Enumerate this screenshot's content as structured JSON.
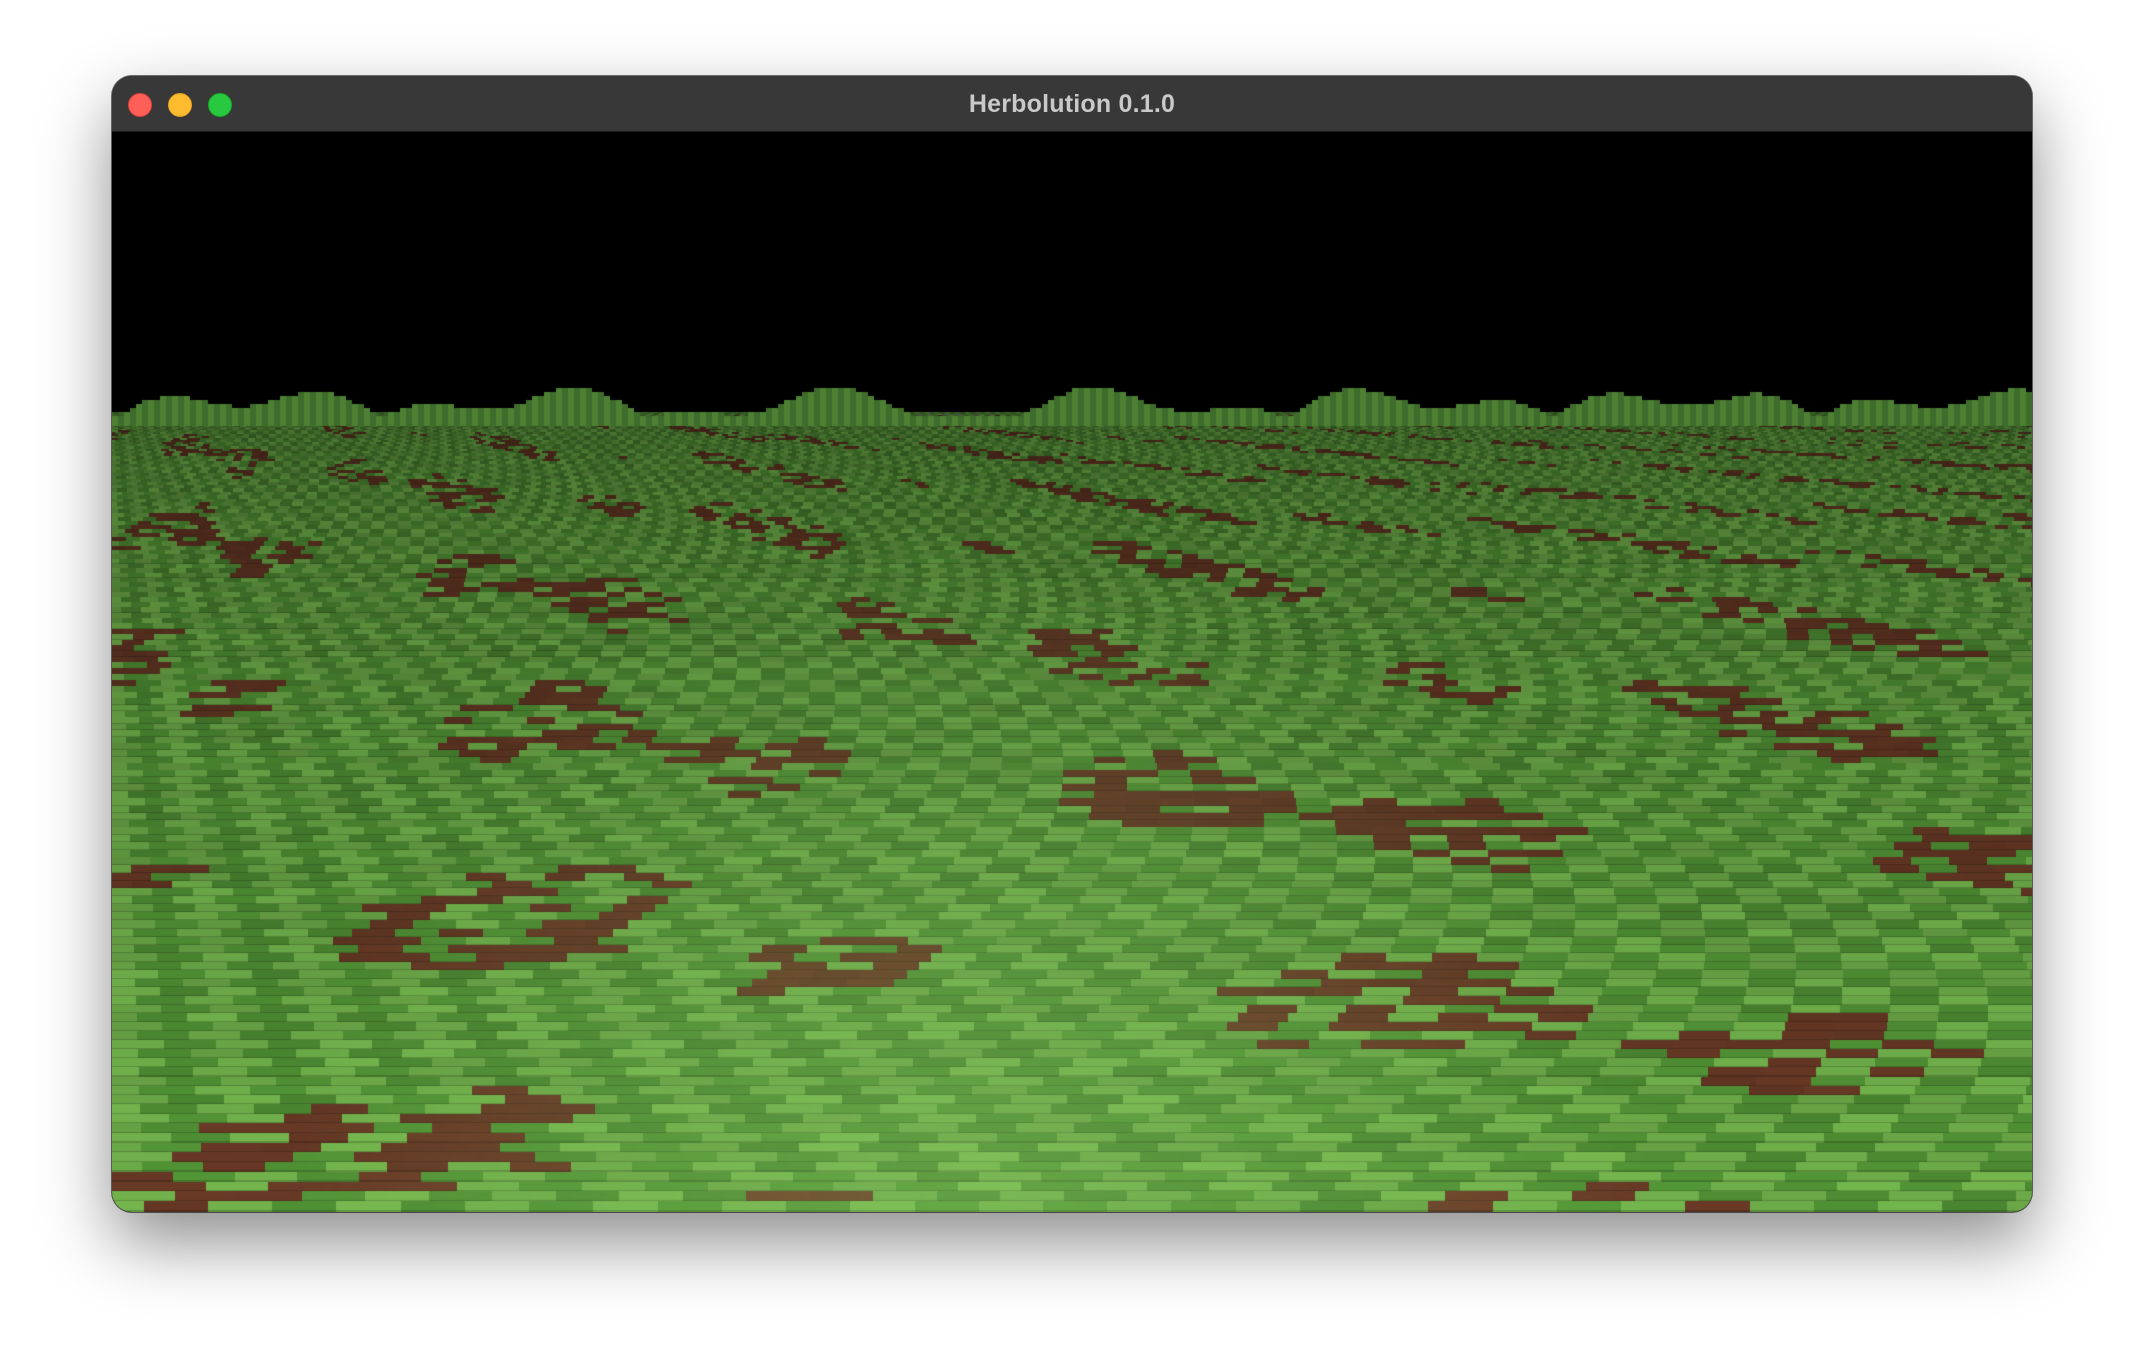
{
  "window": {
    "title": "Herbolution 0.1.0",
    "buttons": {
      "close_color": "#fe5f57",
      "minimize_color": "#febc2e",
      "zoom_color": "#28c840"
    }
  },
  "scene": {
    "sky_color": "#000000",
    "grass_top_color": "#6fae4a",
    "grass_side_color": "#4f8f34",
    "dirt_color": "#6a3a26",
    "stone_color": "#8a8a8a",
    "horizon_fraction": 0.27
  }
}
